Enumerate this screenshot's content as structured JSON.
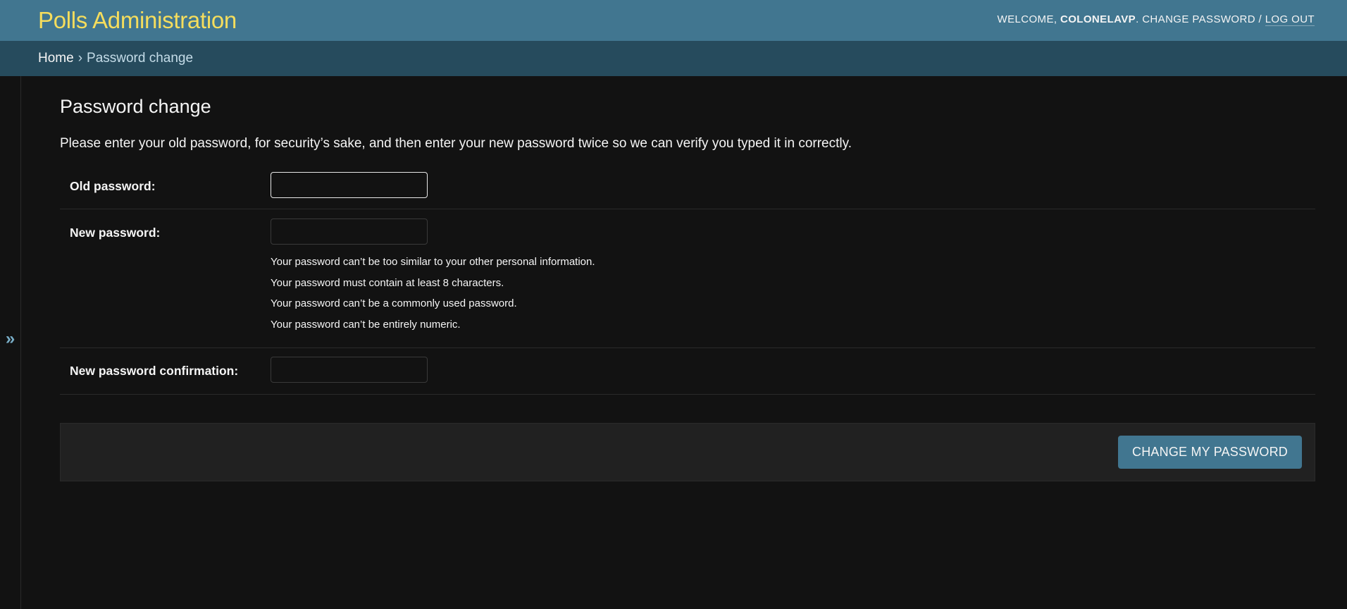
{
  "header": {
    "site_name": "Polls Administration",
    "welcome_label": "WELCOME,",
    "username": "COLONELAVP",
    "change_password": "CHANGE PASSWORD",
    "separator": "/",
    "logout": "LOG OUT"
  },
  "breadcrumbs": {
    "home": "Home",
    "separator": "›",
    "current": "Password change"
  },
  "nav_toggle": {
    "glyph": "»",
    "icon": "double-chevron-right-icon"
  },
  "page": {
    "title": "Password change",
    "intro": "Please enter your old password, for security’s sake, and then enter your new password twice so we can verify you typed it in correctly."
  },
  "form": {
    "old_password": {
      "label": "Old password:",
      "value": ""
    },
    "new_password": {
      "label": "New password:",
      "value": "",
      "help": [
        "Your password can’t be too similar to your other personal information.",
        "Your password must contain at least 8 characters.",
        "Your password can’t be a commonly used password.",
        "Your password can’t be entirely numeric."
      ]
    },
    "confirm_password": {
      "label": "New password confirmation:",
      "value": ""
    },
    "submit_label": "CHANGE MY PASSWORD"
  },
  "colors": {
    "header_bg": "#417690",
    "breadcrumb_bg": "#264b5d",
    "brand_yellow": "#f5dd5d",
    "page_bg": "#121212",
    "button_bg": "#417690"
  }
}
